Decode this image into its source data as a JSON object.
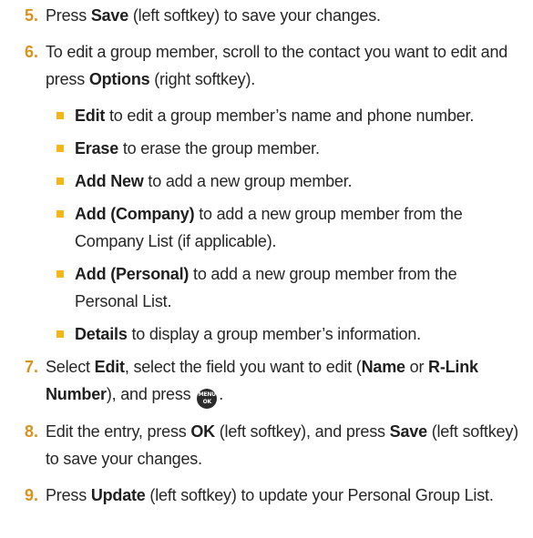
{
  "steps": [
    {
      "num": "5.",
      "pre": "Press ",
      "b1": "Save",
      "post": " (left softkey) to save your changes."
    },
    {
      "num": "6.",
      "pre": "To edit a group member, scroll to the contact you want to edit and press ",
      "b1": "Options",
      "post": " (right softkey)."
    },
    {
      "num": "7.",
      "pre": "Select ",
      "b1": "Edit",
      "mid": ", select the field you want to edit (",
      "b2": "Name",
      "mid2": " or ",
      "b3": "R-Link Number",
      "post": "), and press"
    },
    {
      "num": "8.",
      "pre": "Edit the entry, press ",
      "b1": "OK",
      "mid": " (left softkey), and press ",
      "b2": "Save",
      "post": " (left softkey) to save your changes."
    },
    {
      "num": "9.",
      "pre": "Press ",
      "b1": "Update",
      "post": " (left softkey) to update your Personal Group List."
    }
  ],
  "options": [
    {
      "label": "Edit",
      "desc": " to edit a group member’s name and phone number."
    },
    {
      "label": "Erase",
      "desc": " to erase the group member."
    },
    {
      "label": "Add New",
      "desc": " to add a new group member."
    },
    {
      "label": "Add (Company)",
      "desc": " to add a new group member from the Company List (if applicable)."
    },
    {
      "label": "Add (Personal)",
      "desc": " to add a new group member from the Personal List."
    },
    {
      "label": "Details",
      "desc": " to display a group member’s information."
    }
  ],
  "menu_key": {
    "top": "MENU",
    "bottom": "OK",
    "icon": "menu-ok-key-icon"
  },
  "colors": {
    "number": "#d9921c",
    "bullet": "#f5b61b",
    "text": "#262626"
  }
}
